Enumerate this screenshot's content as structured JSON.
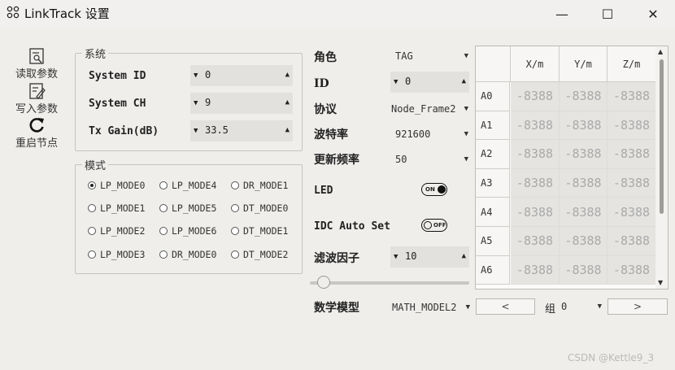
{
  "window": {
    "title": "LinkTrack 设置",
    "icon": "nodes-icon",
    "minimize": "—",
    "maximize": "☐",
    "close": "✕"
  },
  "sidebar": {
    "items": [
      {
        "label": "读取参数",
        "icon": "read-params-icon"
      },
      {
        "label": "写入参数",
        "icon": "write-params-icon"
      },
      {
        "label": "重启节点",
        "icon": "restart-icon"
      }
    ]
  },
  "system": {
    "legend": "系统",
    "fields": [
      {
        "label": "System ID",
        "value": "0"
      },
      {
        "label": "System CH",
        "value": "9"
      },
      {
        "label": "Tx Gain(dB)",
        "value": "33.5"
      }
    ]
  },
  "mode": {
    "legend": "模式",
    "selected": "LP_MODE0",
    "options": [
      "LP_MODE0",
      "LP_MODE4",
      "DR_MODE1",
      "LP_MODE1",
      "LP_MODE5",
      "DT_MODE0",
      "LP_MODE2",
      "LP_MODE6",
      "DT_MODE1",
      "LP_MODE3",
      "DR_MODE0",
      "DT_MODE2"
    ]
  },
  "settings": {
    "role": {
      "label": "角色",
      "value": "TAG"
    },
    "id": {
      "label": "ID",
      "value": "0"
    },
    "protocol": {
      "label": "协议",
      "value": "Node_Frame2"
    },
    "baud": {
      "label": "波特率",
      "value": "921600"
    },
    "rate": {
      "label": "更新频率",
      "value": "50"
    },
    "led": {
      "label": "LED",
      "state": "ON"
    },
    "idc": {
      "label": "IDC Auto Set",
      "state": "OFF"
    },
    "filter": {
      "label": "滤波因子",
      "value": "10"
    },
    "filter_slider_position": 0.05,
    "math_model": {
      "label": "数学模型",
      "value": "MATH_MODEL2"
    }
  },
  "table": {
    "columns": [
      "X/m",
      "Y/m",
      "Z/m"
    ],
    "rows": [
      {
        "name": "A0",
        "values": [
          "-8388",
          "-8388",
          "-8388"
        ]
      },
      {
        "name": "A1",
        "values": [
          "-8388",
          "-8388",
          "-8388"
        ]
      },
      {
        "name": "A2",
        "values": [
          "-8388",
          "-8388",
          "-8388"
        ]
      },
      {
        "name": "A3",
        "values": [
          "-8388",
          "-8388",
          "-8388"
        ]
      },
      {
        "name": "A4",
        "values": [
          "-8388",
          "-8388",
          "-8388"
        ]
      },
      {
        "name": "A5",
        "values": [
          "-8388",
          "-8388",
          "-8388"
        ]
      },
      {
        "name": "A6",
        "values": [
          "-8388",
          "-8388",
          "-8388"
        ]
      }
    ]
  },
  "group": {
    "label": "组",
    "value": "0",
    "prev": "<",
    "next": ">"
  },
  "watermark": "CSDN @Kettle9_3"
}
